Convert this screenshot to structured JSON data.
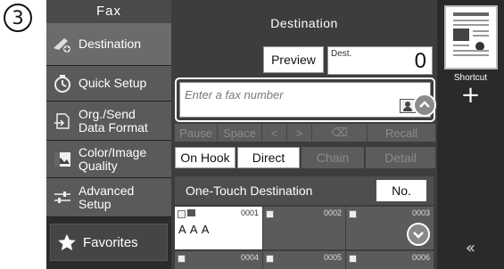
{
  "step_number": "3",
  "sidebar": {
    "title": "Fax",
    "items": [
      {
        "label": "Destination",
        "icon": "destination-icon"
      },
      {
        "label": "Quick Setup",
        "icon": "quick-setup-icon"
      },
      {
        "label": "Org./Send\nData Format",
        "icon": "original-format-icon"
      },
      {
        "label": "Color/Image\nQuality",
        "icon": "image-quality-icon"
      },
      {
        "label": "Advanced\nSetup",
        "icon": "advanced-setup-icon"
      }
    ],
    "favorites": {
      "label": "Favorites",
      "icon": "star-icon"
    }
  },
  "main": {
    "title": "Destination",
    "preview_label": "Preview",
    "dest_label": "Dest.",
    "dest_count": "0",
    "fax_input_placeholder": "Enter a fax number",
    "keys_row1": [
      "Pause",
      "Space",
      "<",
      ">",
      "⌫",
      "Recall"
    ],
    "keys_row2": [
      {
        "label": "On Hook",
        "enabled": true
      },
      {
        "label": "Direct",
        "enabled": true
      },
      {
        "label": "Chain",
        "enabled": false
      },
      {
        "label": "Detail",
        "enabled": false
      }
    ],
    "one_touch_title": "One-Touch Destination",
    "no_button": "No.",
    "tiles": [
      {
        "number": "0001",
        "name": "A A A"
      },
      {
        "number": "0002",
        "name": ""
      },
      {
        "number": "0003",
        "name": ""
      },
      {
        "number": "0004",
        "name": ""
      },
      {
        "number": "0005",
        "name": ""
      },
      {
        "number": "0006",
        "name": ""
      }
    ]
  },
  "rail": {
    "shortcut_label": "Shortcut",
    "add_label": "+",
    "collapse_label": "«"
  }
}
